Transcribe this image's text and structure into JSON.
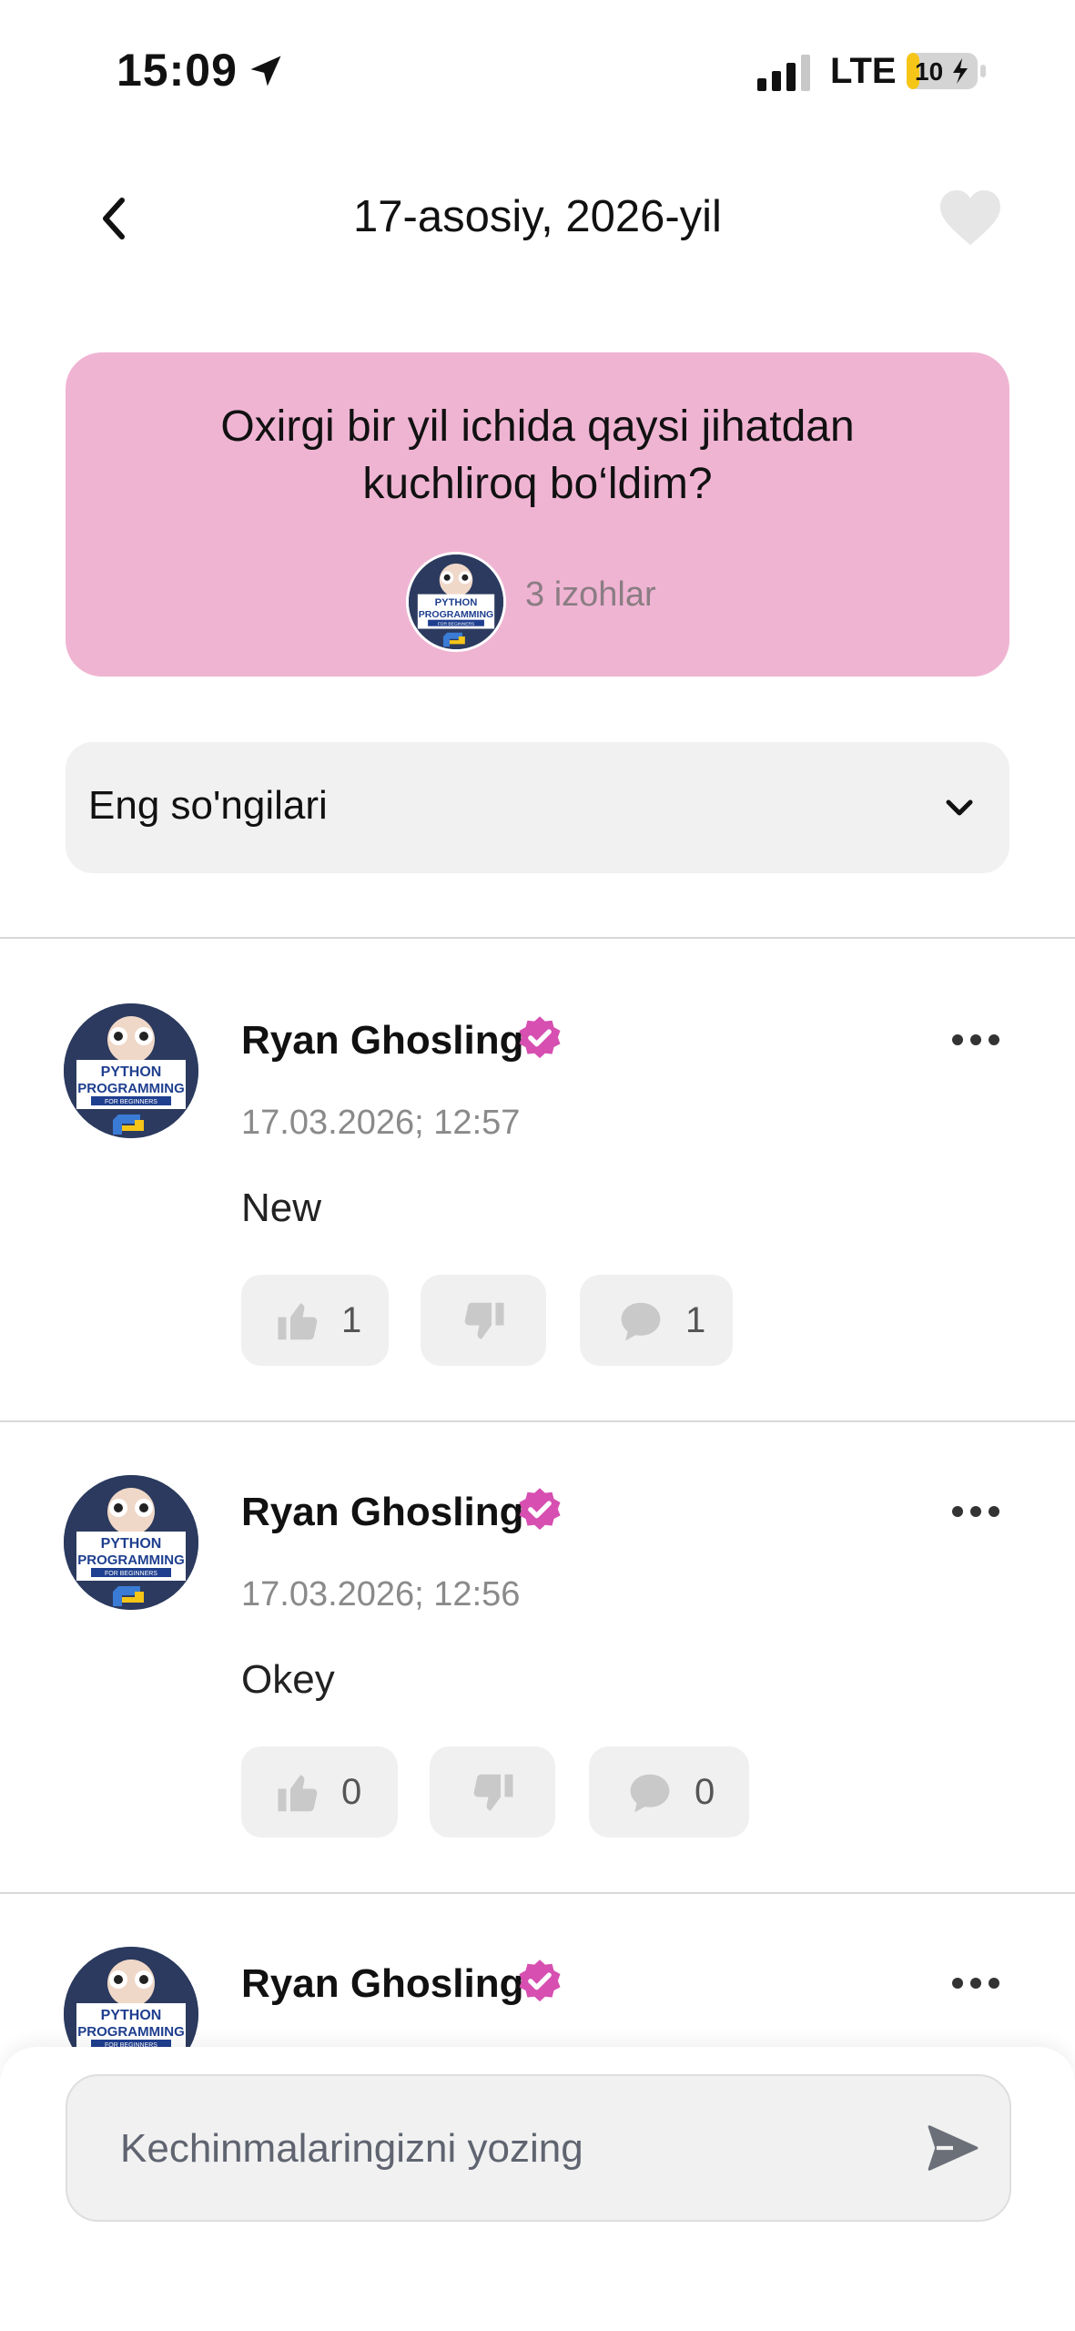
{
  "status_bar": {
    "time": "15:09",
    "network": "LTE",
    "battery": "10"
  },
  "header": {
    "title": "17-asosiy, 2026-yil",
    "back_icon": "chevron-left-icon",
    "favorite_icon": "heart-icon"
  },
  "question": {
    "text": "Oxirgi bir yil ichida qaysi jihatdan kuchliroq bo‘ldim?",
    "comments_count": "3 izohlar"
  },
  "sort": {
    "selected": "Eng so'ngilari"
  },
  "avatar_text": {
    "line1": "PYTHON",
    "line2": "PROGRAMMING",
    "line3": "FOR BEGINNERS"
  },
  "comments": [
    {
      "author": "Ryan Ghosling",
      "date": "17.03.2026; 12:57",
      "text": "New",
      "likes": "1",
      "replies": "1"
    },
    {
      "author": "Ryan Ghosling",
      "date": "17.03.2026; 12:56",
      "text": "Okey",
      "likes": "0",
      "replies": "0"
    },
    {
      "author": "Ryan Ghosling"
    }
  ],
  "composer": {
    "placeholder": "Kechinmalaringizni yozing",
    "send_icon": "send-icon"
  },
  "colors": {
    "card_bg": "#f0b4d3",
    "verified": "#d64fb1",
    "surface": "#f1f1f1"
  }
}
